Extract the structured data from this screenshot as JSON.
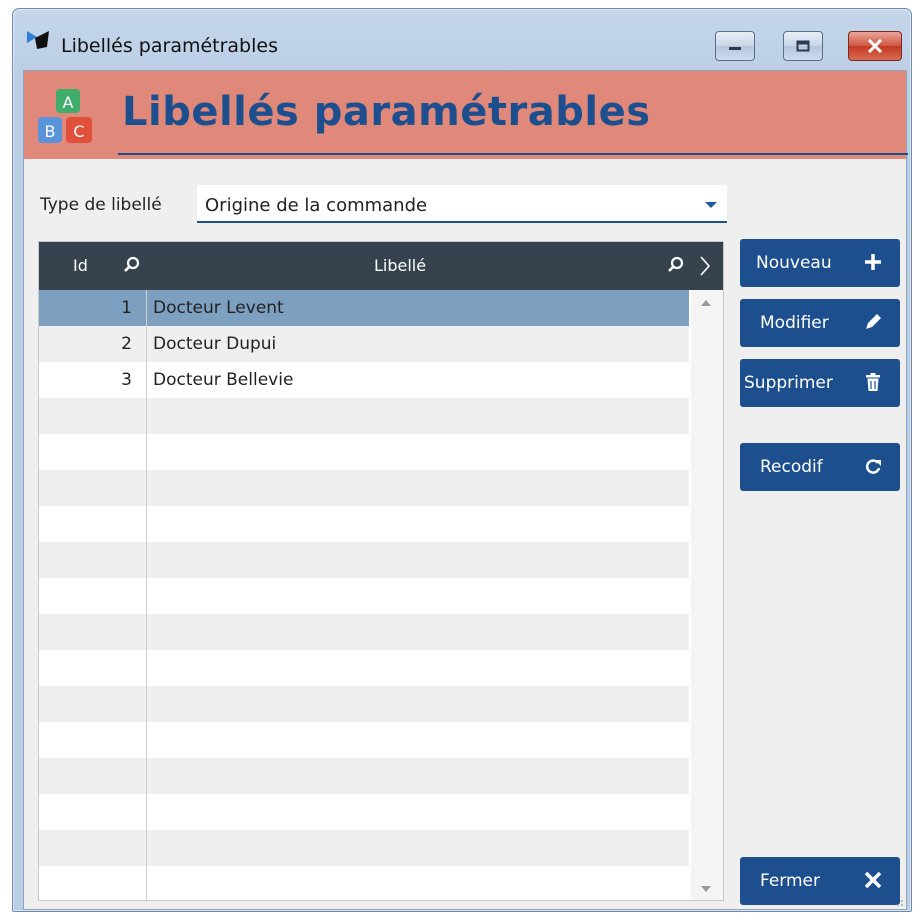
{
  "window": {
    "title": "Libellés paramétrables",
    "controls": {
      "minimize": "minimize",
      "maximize": "maximize",
      "close": "close"
    }
  },
  "banner": {
    "title": "Libellés paramétrables",
    "icon_letters": [
      "A",
      "B",
      "C"
    ],
    "icon_colors": [
      "#3fae6c",
      "#5b93d8",
      "#e0503a"
    ]
  },
  "filter": {
    "label": "Type de libellé",
    "value": "Origine de la commande"
  },
  "grid": {
    "columns": [
      "Id",
      "Libellé"
    ],
    "rows": [
      {
        "id": "1",
        "libelle": "Docteur Levent",
        "selected": true
      },
      {
        "id": "2",
        "libelle": "Docteur Dupui",
        "selected": false
      },
      {
        "id": "3",
        "libelle": "Docteur Bellevie",
        "selected": false
      }
    ],
    "empty_rows": 14
  },
  "actions": {
    "nouveau": "Nouveau",
    "modifier": "Modifier",
    "supprimer": "Supprimer",
    "recodif": "Recodif",
    "fermer": "Fermer"
  },
  "colors": {
    "banner": "#e0897a",
    "accent": "#1d4f8e",
    "header": "#36434e",
    "selected_row": "#7d9fc0"
  }
}
